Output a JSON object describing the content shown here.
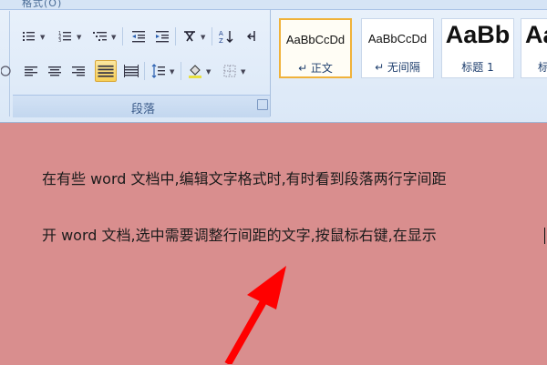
{
  "ribbon": {
    "top_title": "格式(O)",
    "paragraph_group": {
      "label": "段落",
      "buttons": [
        {
          "name": "bullets-button",
          "icon": "bullets-icon"
        },
        {
          "name": "numbering-button",
          "icon": "numbering-icon"
        },
        {
          "name": "multilevel-list-button",
          "icon": "multilevel-list-icon"
        },
        {
          "name": "decrease-indent-button",
          "icon": "decrease-indent-icon"
        },
        {
          "name": "increase-indent-button",
          "icon": "increase-indent-icon"
        },
        {
          "name": "chinese-layout-button",
          "icon": "chinese-layout-icon"
        },
        {
          "name": "sort-button",
          "icon": "sort-icon",
          "glyph": "A↓Z"
        },
        {
          "name": "show-hide-marks-button",
          "icon": "pilcrow-icon",
          "glyph": "↵"
        },
        {
          "name": "align-left-button",
          "icon": "align-left-icon"
        },
        {
          "name": "center-button",
          "icon": "center-icon"
        },
        {
          "name": "align-right-button",
          "icon": "align-right-icon"
        },
        {
          "name": "justify-button",
          "icon": "justify-icon",
          "active": true
        },
        {
          "name": "distributed-button",
          "icon": "distributed-icon"
        },
        {
          "name": "line-spacing-button",
          "icon": "line-spacing-icon"
        },
        {
          "name": "shading-button",
          "icon": "paint-bucket-icon"
        },
        {
          "name": "borders-button",
          "icon": "borders-icon"
        }
      ]
    },
    "styles_group": {
      "items": [
        {
          "sample": "AaBbCcDd",
          "name": "↵ 正文",
          "selected": true
        },
        {
          "sample": "AaBbCcDd",
          "name": "↵ 无间隔",
          "selected": false
        },
        {
          "sample": "AaBb",
          "name": "标题 1",
          "selected": false
        },
        {
          "sample": "Aa",
          "name": "标",
          "selected": false
        }
      ]
    }
  },
  "document": {
    "line1": "在有些 word 文档中,编辑文字格式时,有时看到段落两行字间距",
    "line2": "开 word 文档,选中需要调整行间距的文字,按鼠标右键,在显示"
  },
  "annotation": {
    "arrow_color": "#ff0000"
  }
}
